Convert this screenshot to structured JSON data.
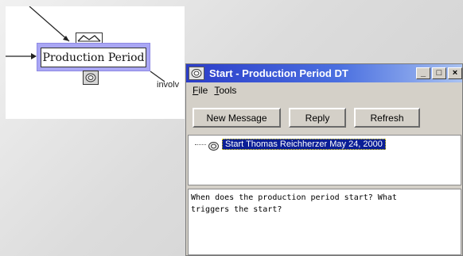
{
  "diagram": {
    "node_label": "Production Period",
    "edge_label": "involv",
    "top_icon": "diamond-flag-icon",
    "bottom_icon": "discussion-icon"
  },
  "window": {
    "title": "Start - Production Period DT",
    "title_icon": "discussion-icon",
    "controls": {
      "minimize": "_",
      "maximize": "□",
      "close": "×"
    },
    "menu": [
      {
        "label": "File"
      },
      {
        "label": "Tools"
      }
    ],
    "toolbar": {
      "new_message": "New Message",
      "reply": "Reply",
      "refresh": "Refresh"
    },
    "thread": {
      "selected_item": "Start  Thomas Reichherzer  May 24, 2000",
      "item_icon": "discussion-icon"
    },
    "message_body": "When does the production period start? What\ntriggers the start?"
  },
  "colors": {
    "node_highlight": "#a9a6f4",
    "titlebar_start": "#2b3dc9",
    "selection": "#0a1e96"
  }
}
